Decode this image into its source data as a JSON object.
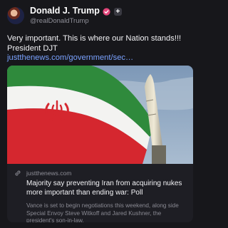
{
  "post": {
    "author": {
      "display_name": "Donald J. Trump",
      "handle": "@realDonaldTrump",
      "verified_icon": "verified-badge-icon",
      "follow_icon": "plus-icon",
      "follow_symbol": "+"
    },
    "text_lines": [
      "Very important. This is where our Nation stands!!!",
      "President DJT"
    ],
    "link_text": "justthenews.com/government/sec…",
    "card": {
      "image_description_icon": "iran-flag-missile-image",
      "domain": "justthenews.com",
      "headline": "Majority say preventing Iran from acquiring nukes more important than ending war: Poll",
      "summary": "Vance is set to begin negotiations this weekend, along side Special Envoy Steve Witkoff and Jared Kushner, the president's son-in-law."
    }
  },
  "colors": {
    "background": "#17171b",
    "card_background": "#1e1e24",
    "link": "#7aa2ff",
    "verified": "#e3457a",
    "muted_text": "#8a8a93"
  }
}
